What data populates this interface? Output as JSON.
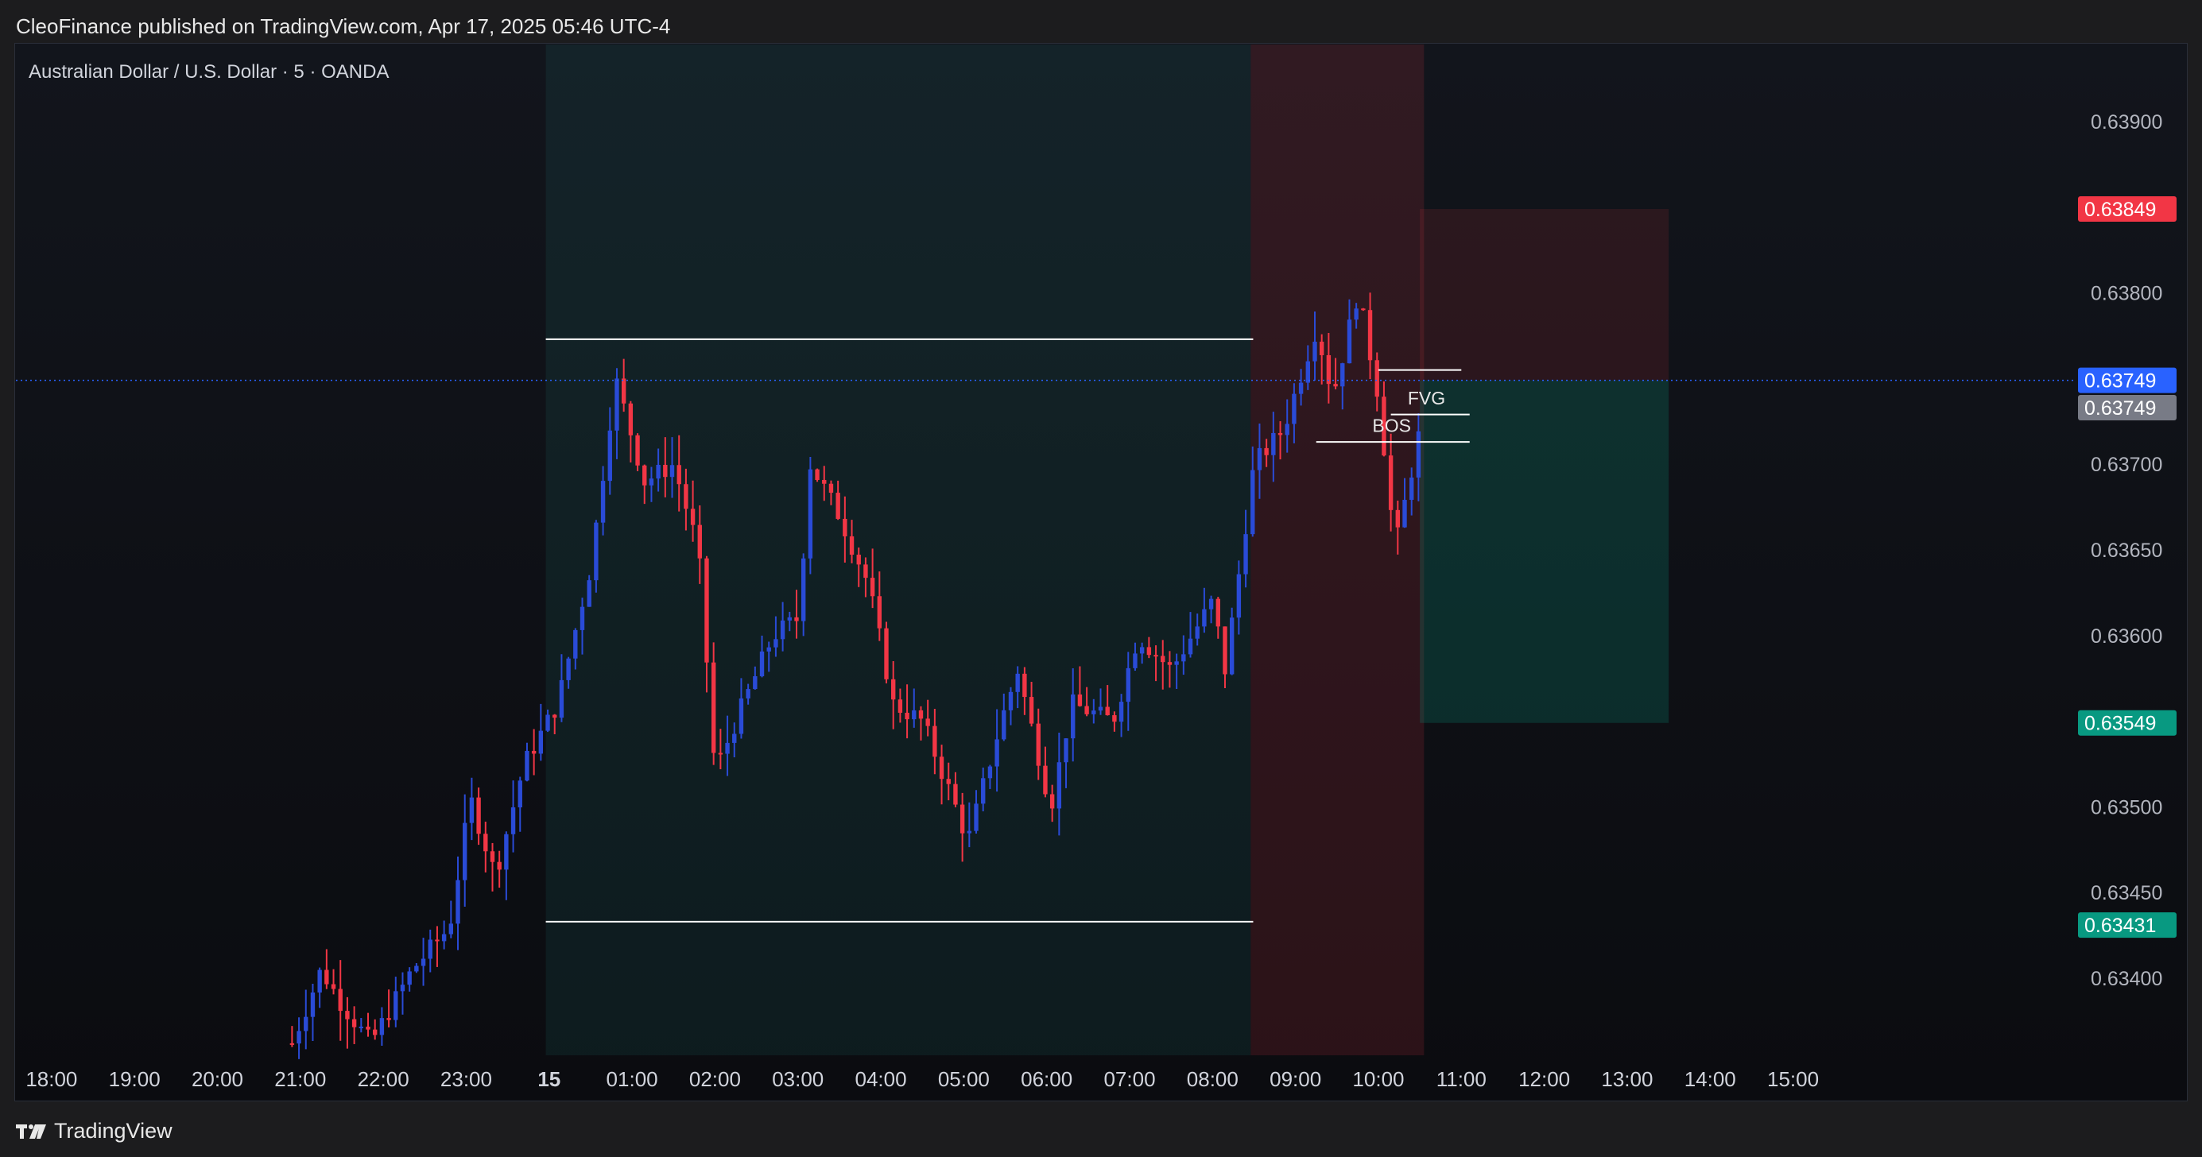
{
  "header": {
    "published": "CleoFinance published on TradingView.com, Apr 17, 2025 05:46 UTC-4"
  },
  "chart_data": {
    "type": "candlestick",
    "title": "Australian Dollar / U.S. Dollar · 5 · OANDA",
    "y_range": [
      0.63355,
      0.63945
    ],
    "y_ticks": [
      "0.63900",
      "0.63850",
      "0.63800",
      "0.63750",
      "0.63700",
      "0.63650",
      "0.63600",
      "0.63550",
      "0.63500",
      "0.63450",
      "0.63400"
    ],
    "x_range": [
      -4.43,
      20.11
    ],
    "x_ticks": [
      {
        "t": -4.0,
        "label": "18:00"
      },
      {
        "t": -5.0,
        "label": ""
      },
      {
        "t": -3.0,
        "label": "19:00"
      },
      {
        "t": -2.0,
        "label": "20:00"
      },
      {
        "t": -1.0,
        "label": "21:00"
      },
      {
        "t": 0.0,
        "label": "22:00"
      },
      {
        "t": 1.0,
        "label": "23:00"
      },
      {
        "t": 2.0,
        "label": "15",
        "bold": true
      },
      {
        "t": 3.0,
        "label": "01:00"
      },
      {
        "t": 4.0,
        "label": "02:00"
      },
      {
        "t": 5.0,
        "label": "03:00"
      },
      {
        "t": 6.0,
        "label": "04:00"
      },
      {
        "t": 7.0,
        "label": "05:00"
      },
      {
        "t": 8.0,
        "label": "06:00"
      },
      {
        "t": 9.0,
        "label": "07:00"
      },
      {
        "t": 10.0,
        "label": "08:00"
      },
      {
        "t": 11.0,
        "label": "09:00"
      },
      {
        "t": 12.0,
        "label": "10:00"
      },
      {
        "t": 13.0,
        "label": "11:00"
      },
      {
        "t": 14.0,
        "label": "12:00"
      },
      {
        "t": 15.0,
        "label": "13:00"
      },
      {
        "t": 16.0,
        "label": "14:00"
      },
      {
        "t": 17.0,
        "label": "15:00"
      }
    ],
    "price_badges": [
      {
        "value": "0.63849",
        "price": 0.63849,
        "color": "#f23645"
      },
      {
        "value": "0.63749",
        "price": 0.63749,
        "color": "#2962ff"
      },
      {
        "value": "0.63749",
        "price": 0.63733,
        "color": "#787b86"
      },
      {
        "value": "0.63549",
        "price": 0.63549,
        "color": "#089981"
      },
      {
        "value": "0.63431",
        "price": 0.63431,
        "color": "#089981"
      }
    ],
    "current_price": 0.63749,
    "zones": [
      {
        "name": "asia-range",
        "t0": 1.96,
        "t1": 10.46,
        "color": "rgba(38,166,154,0.10)"
      },
      {
        "name": "london-session",
        "t0": 10.46,
        "t1": 12.55,
        "color": "rgba(242,54,69,0.14)"
      }
    ],
    "position": {
      "entry": 0.63749,
      "stop": 0.63849,
      "target": 0.63549,
      "t0": 12.5,
      "t1": 15.5
    },
    "lines": [
      {
        "name": "range-high",
        "t0": 1.96,
        "t1": 10.49,
        "price": 0.63773
      },
      {
        "name": "range-low",
        "t0": 1.96,
        "t1": 10.49,
        "price": 0.63433
      },
      {
        "name": "bos-level",
        "t0": 11.25,
        "t1": 13.1,
        "price": 0.63713
      },
      {
        "name": "fvg-top",
        "t0": 12.0,
        "t1": 13.0,
        "price": 0.63755
      },
      {
        "name": "fvg-bottom",
        "t0": 12.15,
        "t1": 13.1,
        "price": 0.63729
      }
    ],
    "labels": [
      {
        "name": "fvg-label",
        "text": "FVG",
        "t": 12.58,
        "price": 0.63739
      },
      {
        "name": "bos-label",
        "text": "BOS",
        "t": 12.16,
        "price": 0.63723
      }
    ],
    "wave": [
      [
        -1.1,
        0.63362
      ],
      [
        -0.75,
        0.63405
      ],
      [
        -0.5,
        0.63385
      ],
      [
        -0.15,
        0.63362
      ],
      [
        0.35,
        0.63405
      ],
      [
        0.8,
        0.6343
      ],
      [
        1.05,
        0.63505
      ],
      [
        1.35,
        0.6346
      ],
      [
        1.7,
        0.63525
      ],
      [
        2.1,
        0.6356
      ],
      [
        2.5,
        0.6364
      ],
      [
        2.8,
        0.6375
      ],
      [
        3.15,
        0.6369
      ],
      [
        3.5,
        0.637
      ],
      [
        3.8,
        0.6365
      ],
      [
        4.0,
        0.6352
      ],
      [
        4.25,
        0.6355
      ],
      [
        4.7,
        0.636
      ],
      [
        5.0,
        0.6361
      ],
      [
        5.15,
        0.637
      ],
      [
        5.5,
        0.6367
      ],
      [
        5.85,
        0.6363
      ],
      [
        6.15,
        0.6356
      ],
      [
        6.5,
        0.6355
      ],
      [
        6.9,
        0.635
      ],
      [
        7.05,
        0.6348
      ],
      [
        7.45,
        0.6355
      ],
      [
        7.65,
        0.6358
      ],
      [
        8.05,
        0.635
      ],
      [
        8.3,
        0.6356
      ],
      [
        8.8,
        0.6355
      ],
      [
        9.1,
        0.636
      ],
      [
        9.5,
        0.6358
      ],
      [
        10.0,
        0.6362
      ],
      [
        10.15,
        0.6358
      ],
      [
        10.3,
        0.6363
      ],
      [
        10.5,
        0.637
      ],
      [
        10.85,
        0.6372
      ],
      [
        11.25,
        0.6378
      ],
      [
        11.45,
        0.6374
      ],
      [
        11.75,
        0.638
      ],
      [
        12.0,
        0.6374
      ],
      [
        12.2,
        0.6365
      ],
      [
        12.5,
        0.6372
      ],
      [
        12.54,
        0.63749
      ]
    ]
  },
  "footer": {
    "brand": "TradingView"
  }
}
